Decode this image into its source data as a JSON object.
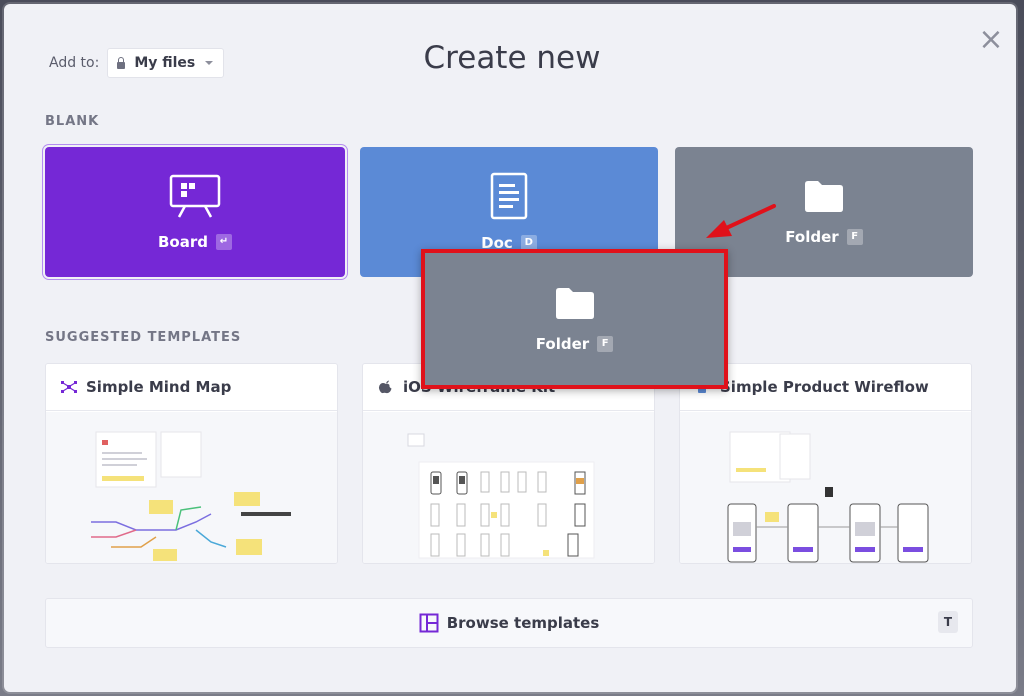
{
  "header": {
    "add_to_label": "Add to:",
    "add_to_value": "My files",
    "title": "Create new"
  },
  "blank": {
    "section_label": "BLANK",
    "board_label": "Board",
    "board_key": "↵",
    "doc_label": "Doc",
    "doc_key": "D",
    "folder_label": "Folder",
    "folder_key": "F"
  },
  "templates": {
    "section_label": "SUGGESTED TEMPLATES",
    "items": [
      {
        "title": "Simple Mind Map",
        "icon": "mind-map-icon"
      },
      {
        "title": "iOS Wireframe Kit",
        "icon": "apple-icon"
      },
      {
        "title": "Simple Product Wireflow",
        "icon": "wireflow-icon"
      }
    ]
  },
  "browse": {
    "label": "Browse templates",
    "key": "T"
  },
  "drag_ghost": {
    "label": "Folder",
    "key": "F"
  },
  "colors": {
    "board": "#7528d6",
    "doc": "#5b8ad6",
    "folder": "#7b8391",
    "highlight": "#e0111a"
  }
}
